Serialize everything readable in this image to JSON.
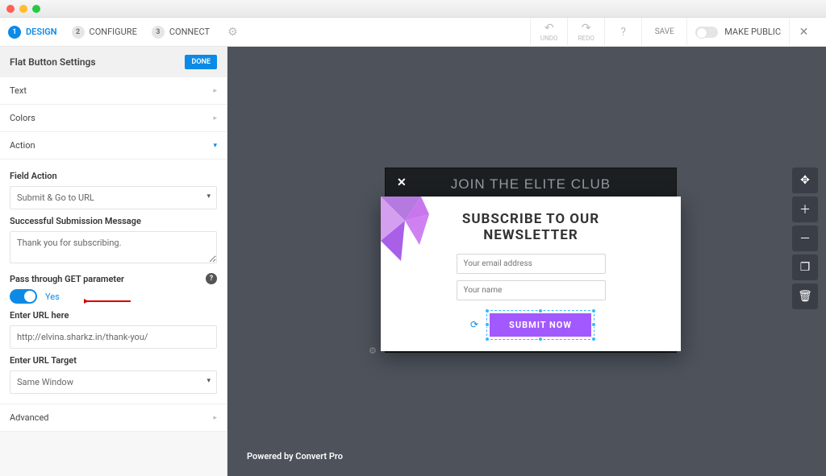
{
  "steps": [
    {
      "num": "1",
      "label": "DESIGN"
    },
    {
      "num": "2",
      "label": "CONFIGURE"
    },
    {
      "num": "3",
      "label": "CONNECT"
    }
  ],
  "toolbar": {
    "undo": "UNDO",
    "redo": "REDO",
    "save": "SAVE",
    "publish": "MAKE PUBLIC"
  },
  "panel": {
    "title": "Flat Button Settings",
    "done": "DONE",
    "sections": {
      "text": "Text",
      "colors": "Colors",
      "action": "Action",
      "advanced": "Advanced"
    },
    "field_action_label": "Field Action",
    "field_action_value": "Submit & Go to URL",
    "success_label": "Successful Submission Message",
    "success_value": "Thank you for subscribing.",
    "passthrough_label": "Pass through GET parameter",
    "toggle_label": "Yes",
    "url_label": "Enter URL here",
    "url_value": "http://elvina.sharkz.in/thank-you/",
    "target_label": "Enter URL Target",
    "target_value": "Same Window"
  },
  "popup": {
    "back_headline": "JOIN THE ELITE CLUB",
    "front_title_line1": "SUBSCRIBE TO OUR",
    "front_title_line2": "NEWSLETTER",
    "email_placeholder": "Your email address",
    "name_placeholder": "Your name",
    "submit": "SUBMIT NOW"
  },
  "footer": "Powered by Convert Pro"
}
